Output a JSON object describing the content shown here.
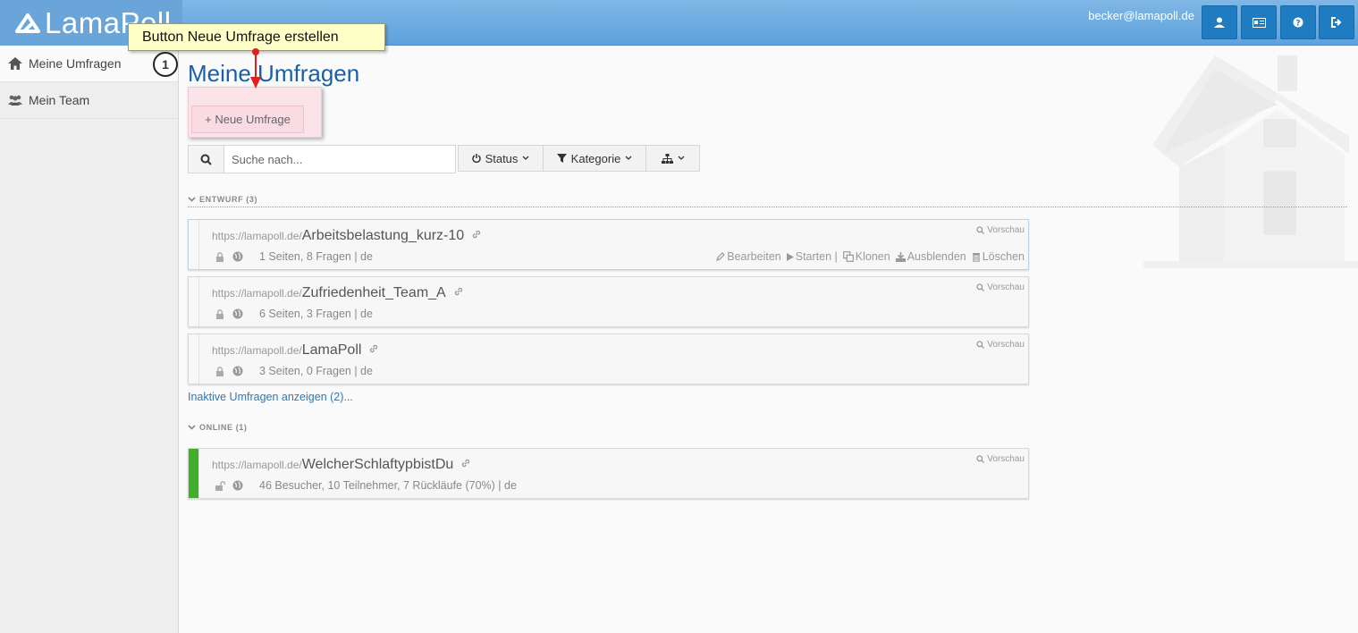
{
  "header": {
    "logo_text": "LamaPoll",
    "user_email": "becker@lamapoll.de",
    "icons": [
      "user-icon",
      "id-card-icon",
      "help-icon",
      "logout-icon"
    ]
  },
  "sidebar": {
    "items": [
      {
        "label": "Meine Umfragen",
        "icon": "home-icon"
      },
      {
        "label": "Mein Team",
        "icon": "team-icon"
      }
    ]
  },
  "annotation": {
    "callout": "Button Neue Umfrage erstellen",
    "step": "1"
  },
  "main": {
    "title": "Meine Umfragen",
    "new_button": "+ Neue Umfrage",
    "search_placeholder": "Suche nach...",
    "filters": {
      "status": "Status",
      "category": "Kategorie"
    },
    "sections": {
      "draft": "ENTWURF (3)",
      "online": "ONLINE (1)"
    },
    "preview_label": "Vorschau",
    "actions": {
      "edit": "Bearbeiten",
      "start": "Starten |",
      "clone": "Klonen",
      "hide": "Ausblenden",
      "delete": "Löschen"
    },
    "url_prefix": "https://lamapoll.de/",
    "draft_surveys": [
      {
        "name": "Arbeitsbelastung_kurz-10",
        "meta": "1 Seiten, 8 Fragen | de"
      },
      {
        "name": "Zufriedenheit_Team_A",
        "meta": "6 Seiten, 3 Fragen | de"
      },
      {
        "name": "LamaPoll",
        "meta": "3 Seiten, 0 Fragen | de"
      }
    ],
    "inactive_link": "Inaktive Umfragen anzeigen (2)...",
    "online_surveys": [
      {
        "name": "WelcherSchlaftypbistDu",
        "meta": "46 Besucher, 10 Teilnehmer, 7 Rückläufe (70%) | de",
        "status_color": "#3fae2a"
      }
    ]
  },
  "colors": {
    "accent": "#1f7cc0",
    "header": "#6aa5d9",
    "title": "#1b5fa6",
    "online": "#3fae2a"
  }
}
